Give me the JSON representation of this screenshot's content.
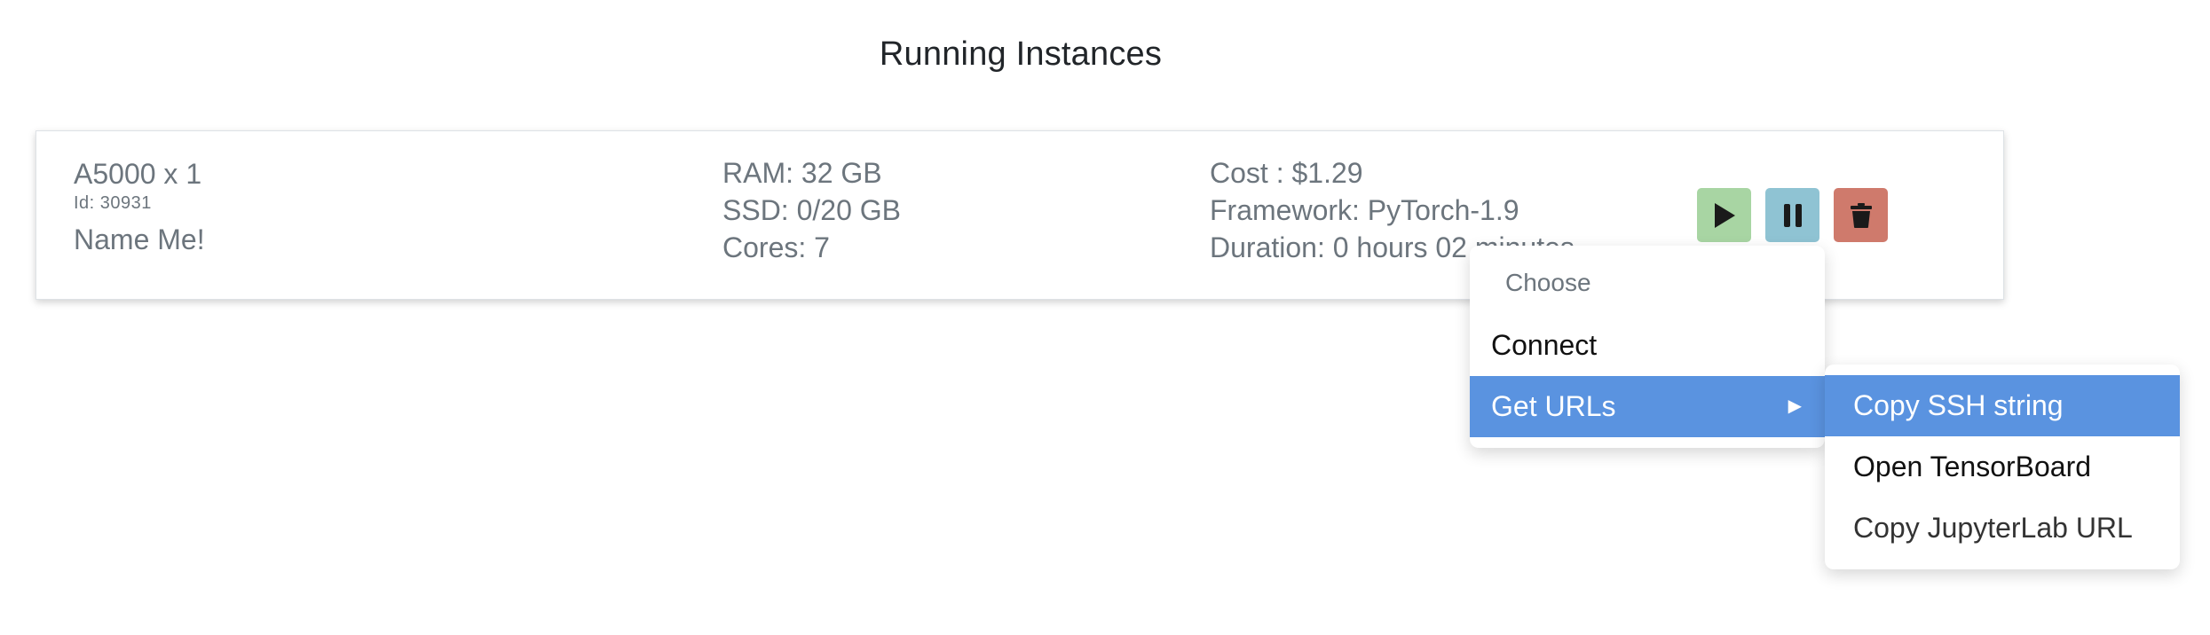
{
  "page": {
    "title": "Running Instances"
  },
  "instance": {
    "gpu": "A5000 x 1",
    "id_text": "Id: 30931",
    "name": "Name Me!",
    "ram": "RAM: 32 GB",
    "ssd": "SSD: 0/20 GB",
    "cores": "Cores: 7",
    "cost": "Cost : $1.29",
    "framework": "Framework: PyTorch-1.9",
    "duration": "Duration: 0 hours 02 minutes"
  },
  "actions": {
    "start_icon": "play-icon",
    "pause_icon": "pause-icon",
    "delete_icon": "trash-icon",
    "colors": {
      "start": "#a8d5a3",
      "pause": "#8fc3d3",
      "delete": "#cf7a6c"
    }
  },
  "menu": {
    "header": "Choose",
    "items": [
      {
        "label": "Connect"
      },
      {
        "label": "Get URLs",
        "arrow": "▶"
      }
    ],
    "active_color": "#5a93e0"
  },
  "submenu": {
    "items": [
      {
        "label": "Copy SSH string"
      },
      {
        "label": "Open TensorBoard"
      },
      {
        "label": "Copy JupyterLab URL"
      }
    ]
  }
}
